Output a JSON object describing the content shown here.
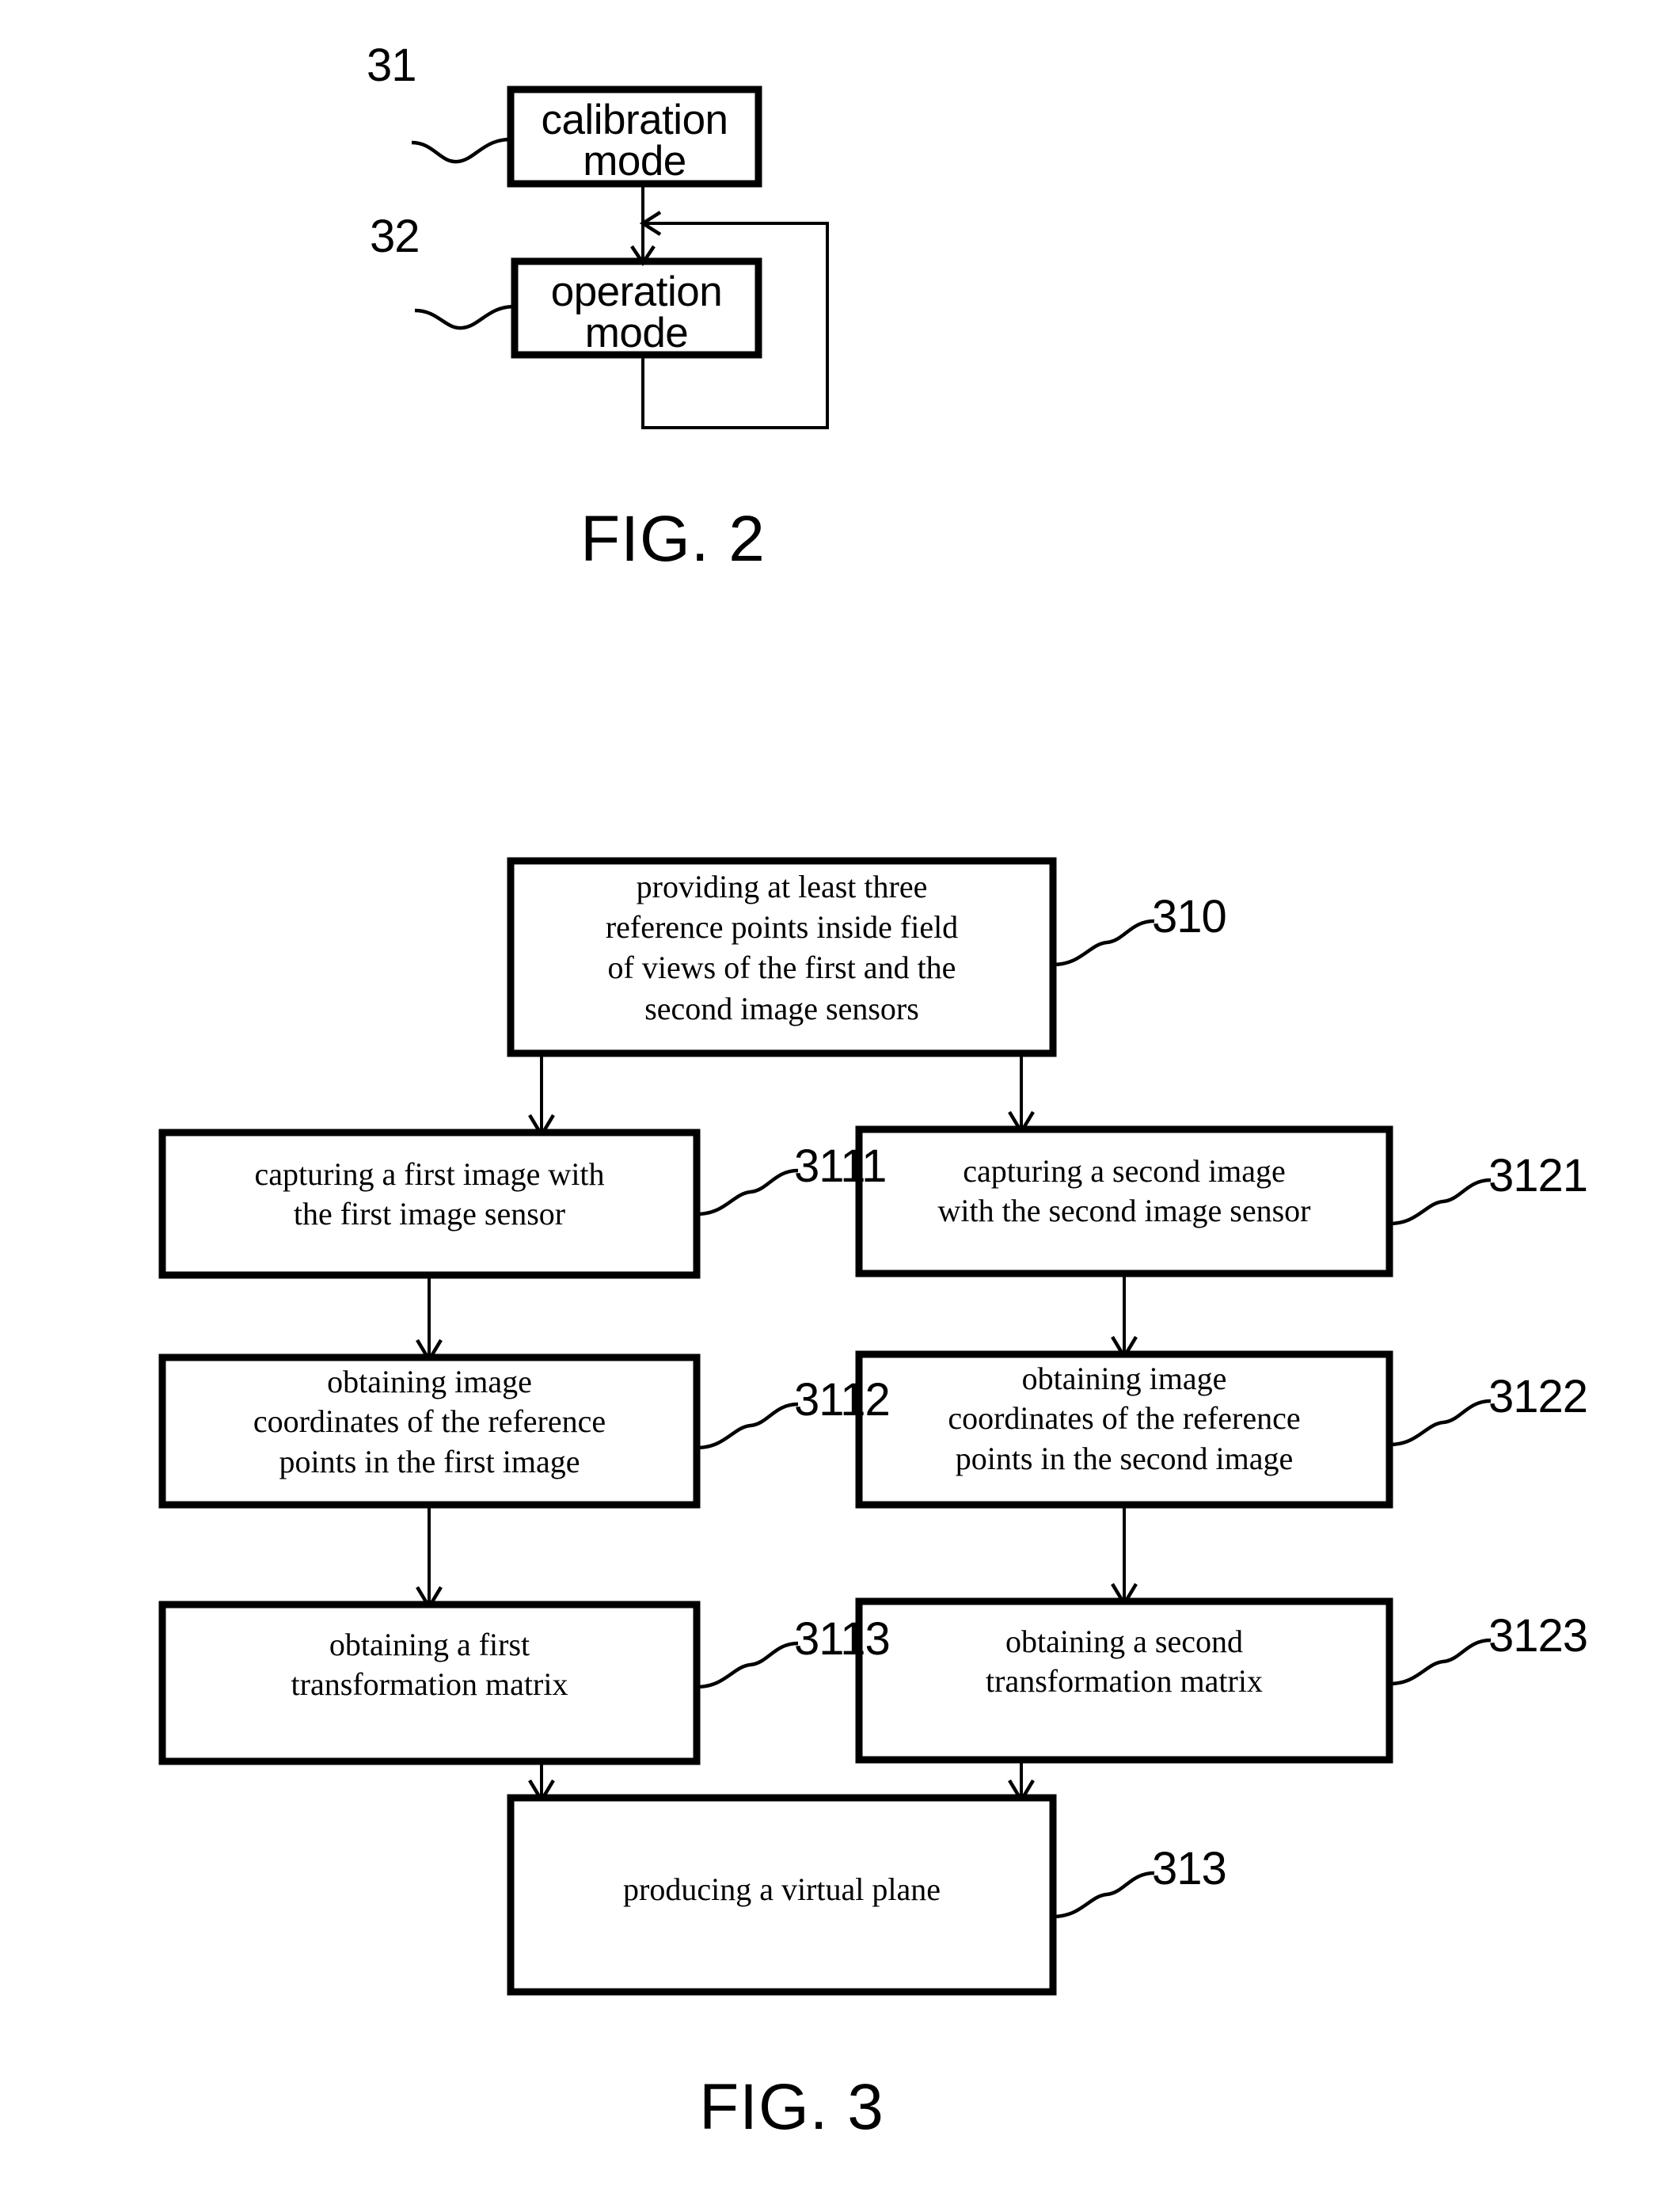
{
  "document": {
    "type": "patent-drawing-sheet",
    "figures": [
      "FIG. 2",
      "FIG. 3"
    ]
  },
  "fig2": {
    "caption": "FIG. 2",
    "boxes": [
      {
        "id": "calibration-mode",
        "text": "calibration\nmode",
        "ref": "31"
      },
      {
        "id": "operation-mode",
        "text": "operation\nmode",
        "ref": "32"
      }
    ],
    "refs": {
      "calibration": "31",
      "operation": "32"
    },
    "flow": "calibration mode -> operation mode, with feedback loop from operation mode back to the link above operation mode"
  },
  "fig3": {
    "caption": "FIG. 3",
    "boxes": [
      {
        "id": "providing-reference-points",
        "text": "providing at least three\nreference points inside field\nof views of the first and the\nsecond image sensors",
        "ref": "310"
      },
      {
        "id": "capture-first-image",
        "text": "capturing a first image with\nthe first image sensor",
        "ref": "3111"
      },
      {
        "id": "capture-second-image",
        "text": "capturing a second image\nwith the second image sensor",
        "ref": "3121"
      },
      {
        "id": "obtain-first-coordinates",
        "text": "obtaining image\ncoordinates of the reference\npoints in the first image",
        "ref": "3112"
      },
      {
        "id": "obtain-second-coordinates",
        "text": "obtaining image\ncoordinates of the reference\npoints in the second image",
        "ref": "3122"
      },
      {
        "id": "first-transformation-matrix",
        "text": "obtaining a first\ntransformation matrix",
        "ref": "3113"
      },
      {
        "id": "second-transformation-matrix",
        "text": "obtaining a second\ntransformation matrix",
        "ref": "3123"
      },
      {
        "id": "produce-virtual-plane",
        "text": "producing a virtual plane",
        "ref": "313"
      }
    ],
    "refs": {
      "providing": "310",
      "capture_first": "3111",
      "capture_second": "3121",
      "coords_first": "3112",
      "coords_second": "3122",
      "matrix_first": "3113",
      "matrix_second": "3123",
      "virtual_plane": "313"
    }
  },
  "colors": {
    "ink": "#000000",
    "paper": "#ffffff"
  }
}
